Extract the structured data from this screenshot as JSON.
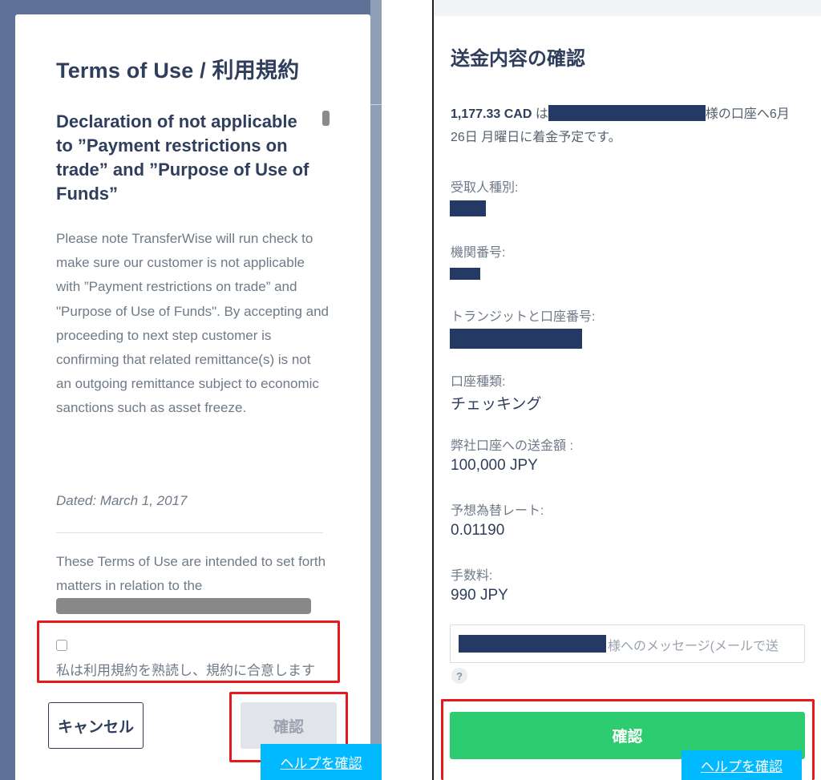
{
  "left": {
    "title": "Terms of Use / 利用規約",
    "section_heading": "Declaration of not applicable to ”Payment restrictions on trade” and ”Purpose of Use of Funds”",
    "body": "Please note TransferWise will run check to make sure our customer is not applicable with ”Payment restrictions on trade” and \"Purpose of Use of Funds\". By accepting and proceeding to next step customer is confirming that related remittance(s) is not an outgoing remittance subject to economic sanctions such as asset freeze.",
    "dated": "Dated: March 1, 2017",
    "terms_intro": "These Terms of Use are intended to set forth matters in relation to the",
    "agree_label": "私は利用規約を熟読し、規約に合意します",
    "cancel_label": "キャンセル",
    "confirm_label": "確認",
    "help_label": "ヘルプを確認"
  },
  "right": {
    "title": "送金内容の確認",
    "summary_amount": "1,177.33 CAD",
    "summary_particle": " は",
    "summary_rest": "様の口座へ6月 26日 月曜日に着金予定です。",
    "fields": {
      "recipient_type_label": "受取人種別:",
      "institution_number_label": "機関番号:",
      "transit_account_label": "トランジットと口座番号:",
      "account_type_label": "口座種類:",
      "account_type_value": "チェッキング",
      "send_amount_label": "弊社口座への送金額 :",
      "send_amount_value": "100,000 JPY",
      "rate_label": "予想為替レート:",
      "rate_value": "0.01190",
      "fee_label": "手数料:",
      "fee_value": "990 JPY"
    },
    "message_placeholder": "様へのメッセージ(メールで送",
    "help_icon_glyph": "?",
    "confirm_label": "確認",
    "help_label": "ヘルプを確認"
  },
  "colors": {
    "navy": "#2e3e5c",
    "backdrop": "#5e7196",
    "redaction": "#243a64",
    "green_button": "#2ecc71",
    "help_blue": "#00b9ff",
    "highlight_red": "#e8191b"
  }
}
